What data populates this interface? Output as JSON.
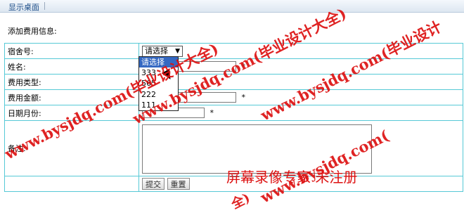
{
  "breadcrumb": {
    "item": "显示桌面"
  },
  "section_title": "添加费用信息:",
  "form": {
    "dorm_label": "宿舍号:",
    "dorm_selected": "请选择",
    "dorm_options": [
      "请选择",
      "333",
      "565",
      "222",
      "111"
    ],
    "name_label": "姓名:",
    "name_value": "",
    "fee_type_label": "费用类型:",
    "amount_label": "费用金额:",
    "amount_value": "",
    "date_label": "日期月份:",
    "date_value": "",
    "remark_label": "备注:",
    "remark_value": "",
    "required_mark": "*",
    "submit_label": "提交",
    "reset_label": "重置"
  },
  "watermarks": {
    "site_a": "www.bysjdq.com(毕业设计大全)",
    "site_b": "www.bysjdq.com(毕业设计",
    "site_c": "www.bysjdq.com(毕业设计大全)",
    "site_d": "www.bysjdq.com(",
    "recorder": "屏幕录像专家  未注册",
    "fragment": "全)"
  },
  "colors": {
    "grid_border": "#56c9d6",
    "watermark": "#dd1111",
    "selected_option": "#3468c2"
  }
}
